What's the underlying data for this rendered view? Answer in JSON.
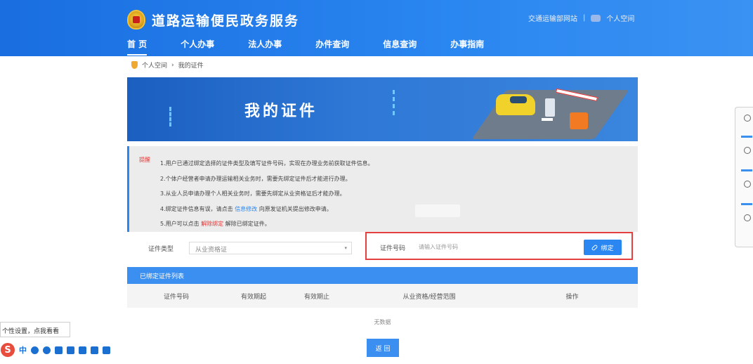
{
  "header": {
    "site_title": "道路运输便民政务服务",
    "top_link_1": "交通运输部网站",
    "top_sep": "|",
    "top_link_2": "个人空间"
  },
  "nav": {
    "items": [
      {
        "label": "首 页",
        "active": true
      },
      {
        "label": "个人办事",
        "active": false
      },
      {
        "label": "法人办事",
        "active": false
      },
      {
        "label": "办件查询",
        "active": false
      },
      {
        "label": "信息查询",
        "active": false
      },
      {
        "label": "办事指南",
        "active": false
      }
    ]
  },
  "breadcrumb": {
    "home": "个人空间",
    "sep": "›",
    "current": "我的证件"
  },
  "banner": {
    "title": "我的证件"
  },
  "notice": {
    "label": "提醒",
    "line1": "1.用户已通过绑定选择的证件类型及填写证件号码，实现在办理业务前获取证件信息。",
    "line2": "2.个体户经营者申请办理运输相关业务时，需要先绑定证件后才能进行办理。",
    "line3": "3.从业人员申请办理个人相关业务时，需要先绑定从业资格证后才能办理。",
    "line4_pre": "4.绑定证件信息有误，请点击",
    "line4_link": "信息修改",
    "line4_post": "向原发证机关提出修改申请。",
    "line5_pre": "5.用户可以点击",
    "line5_link": "解除绑定",
    "line5_post": "解除已绑定证件。"
  },
  "form": {
    "type_label": "证件类型",
    "type_value": "从业资格证",
    "number_label": "证件号码",
    "number_placeholder": "请输入证件号码",
    "bind_button": "绑定"
  },
  "table": {
    "title": "已绑定证件列表",
    "columns": [
      "证件号码",
      "有效期起",
      "有效期止",
      "从业资格/经营范围",
      "操作"
    ],
    "empty_text": "无数据"
  },
  "return_button": "返 回",
  "ime": {
    "tip": "个性设置，点我看看",
    "s_label": "S",
    "zh_label": "中"
  }
}
